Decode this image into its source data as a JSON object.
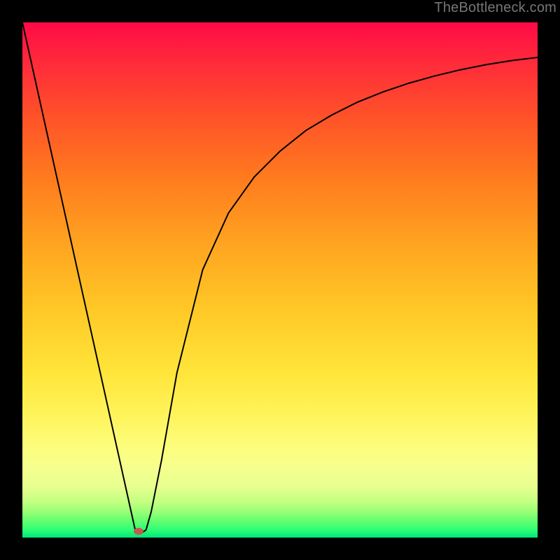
{
  "watermark": "TheBottleneck.com",
  "marker": {
    "x_pct": 22.6,
    "y_pct": 98.8
  },
  "chart_data": {
    "type": "line",
    "title": "",
    "xlabel": "",
    "ylabel": "",
    "xlim": [
      0,
      100
    ],
    "ylim": [
      0,
      100
    ],
    "grid": false,
    "legend": false,
    "annotations": [
      "TheBottleneck.com"
    ],
    "series": [
      {
        "name": "bottleneck-curve",
        "x": [
          0,
          5,
          10,
          15,
          19,
          21,
          22,
          23,
          24,
          25,
          27,
          30,
          35,
          40,
          45,
          50,
          55,
          60,
          65,
          70,
          75,
          80,
          85,
          90,
          95,
          100
        ],
        "y": [
          100,
          77.5,
          55,
          32.5,
          14.5,
          5.5,
          1,
          0.8,
          1.5,
          5,
          15,
          32,
          52,
          63,
          70,
          75,
          79,
          82,
          84.5,
          86.5,
          88.2,
          89.6,
          90.8,
          91.8,
          92.6,
          93.2
        ]
      }
    ],
    "marker": {
      "x": 22.6,
      "y": 1.2,
      "color": "#c45a52"
    },
    "gradient": {
      "direction": "vertical",
      "stops": [
        {
          "pct": 0,
          "color": "#ff0a46"
        },
        {
          "pct": 8,
          "color": "#ff2b3a"
        },
        {
          "pct": 18,
          "color": "#ff5129"
        },
        {
          "pct": 30,
          "color": "#ff7a1e"
        },
        {
          "pct": 42,
          "color": "#ffa120"
        },
        {
          "pct": 56,
          "color": "#ffc926"
        },
        {
          "pct": 68,
          "color": "#ffe53a"
        },
        {
          "pct": 76,
          "color": "#fff35a"
        },
        {
          "pct": 82,
          "color": "#fdfd7a"
        },
        {
          "pct": 86,
          "color": "#f7ff8d"
        },
        {
          "pct": 90,
          "color": "#e8ff8f"
        },
        {
          "pct": 93,
          "color": "#c4ff82"
        },
        {
          "pct": 95,
          "color": "#98ff76"
        },
        {
          "pct": 97,
          "color": "#5cff70"
        },
        {
          "pct": 98.5,
          "color": "#2dff77"
        },
        {
          "pct": 100,
          "color": "#00e57a"
        }
      ]
    }
  }
}
